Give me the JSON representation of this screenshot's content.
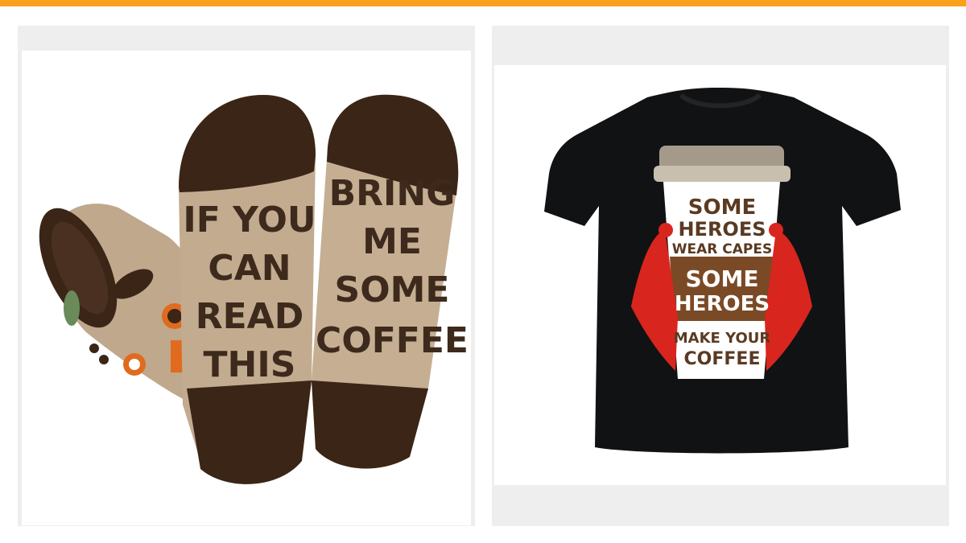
{
  "products": [
    {
      "item": "socks",
      "print_lines": {
        "left_sock": [
          "IF YOU",
          "CAN",
          "READ",
          "THIS"
        ],
        "right_sock": [
          "BRING",
          "ME",
          "SOME",
          "COFFEE"
        ]
      }
    },
    {
      "item": "t-shirt",
      "print_lines": [
        "SOME",
        "HEROES",
        "WEAR CAPES",
        "SOME",
        "HEROES",
        "MAKE YOUR",
        "COFFEE"
      ]
    }
  ],
  "colors": {
    "accent_bar": "#f7a21a",
    "card_bg": "#eeeeee",
    "sock_tan": "#bfa88c",
    "sock_brown": "#3a2517",
    "shirt_black": "#111214",
    "cape_red": "#d8261e",
    "cup_brown": "#7a4a26"
  }
}
